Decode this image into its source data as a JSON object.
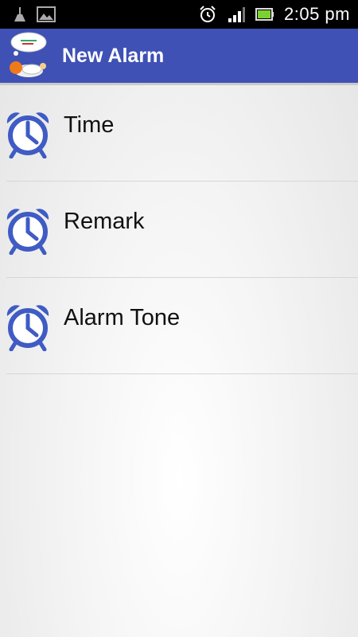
{
  "status_bar": {
    "time": "2:05 pm",
    "icons": [
      "cleaner-icon",
      "image-icon",
      "alarm-clock-icon",
      "signal-icon",
      "battery-icon"
    ]
  },
  "app_bar": {
    "title": "New Alarm",
    "logo": "sleeping-character-logo"
  },
  "list": {
    "items": [
      {
        "label": "Time",
        "icon": "alarm-clock-icon"
      },
      {
        "label": "Remark",
        "icon": "alarm-clock-icon"
      },
      {
        "label": "Alarm Tone",
        "icon": "alarm-clock-icon"
      }
    ]
  },
  "colors": {
    "app_bar": "#3f51b5",
    "icon": "#3f5bc4",
    "status_bar": "#000000"
  }
}
